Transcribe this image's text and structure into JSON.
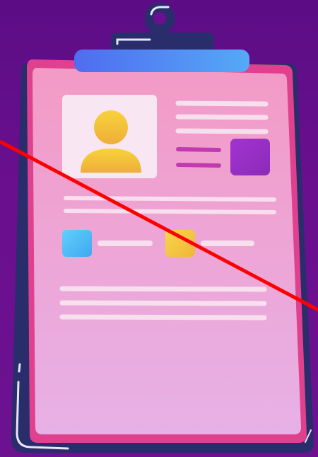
{
  "illustration": {
    "subject": "clipboard-resume",
    "colors": {
      "background_top": "#5b0d86",
      "background_bottom": "#6c1290",
      "board": "#2a2d6b",
      "paper_border": "#e0418f",
      "paper_top": "#f39ac6",
      "paper_bottom": "#e7b1e6",
      "clip_bar_left": "#4f6cf0",
      "clip_bar_right": "#55a9f7",
      "avatar_box": "#f8e7f2",
      "avatar": "#f4c437",
      "accent_purple": "#9b2fc6",
      "accent_magenta": "#c23ab0",
      "accent_blue": "#55c4f7",
      "accent_yellow": "#f6cc3a",
      "text_lines": "#f7dfee",
      "strike_line": "#ff0000"
    },
    "strike_through": true
  }
}
